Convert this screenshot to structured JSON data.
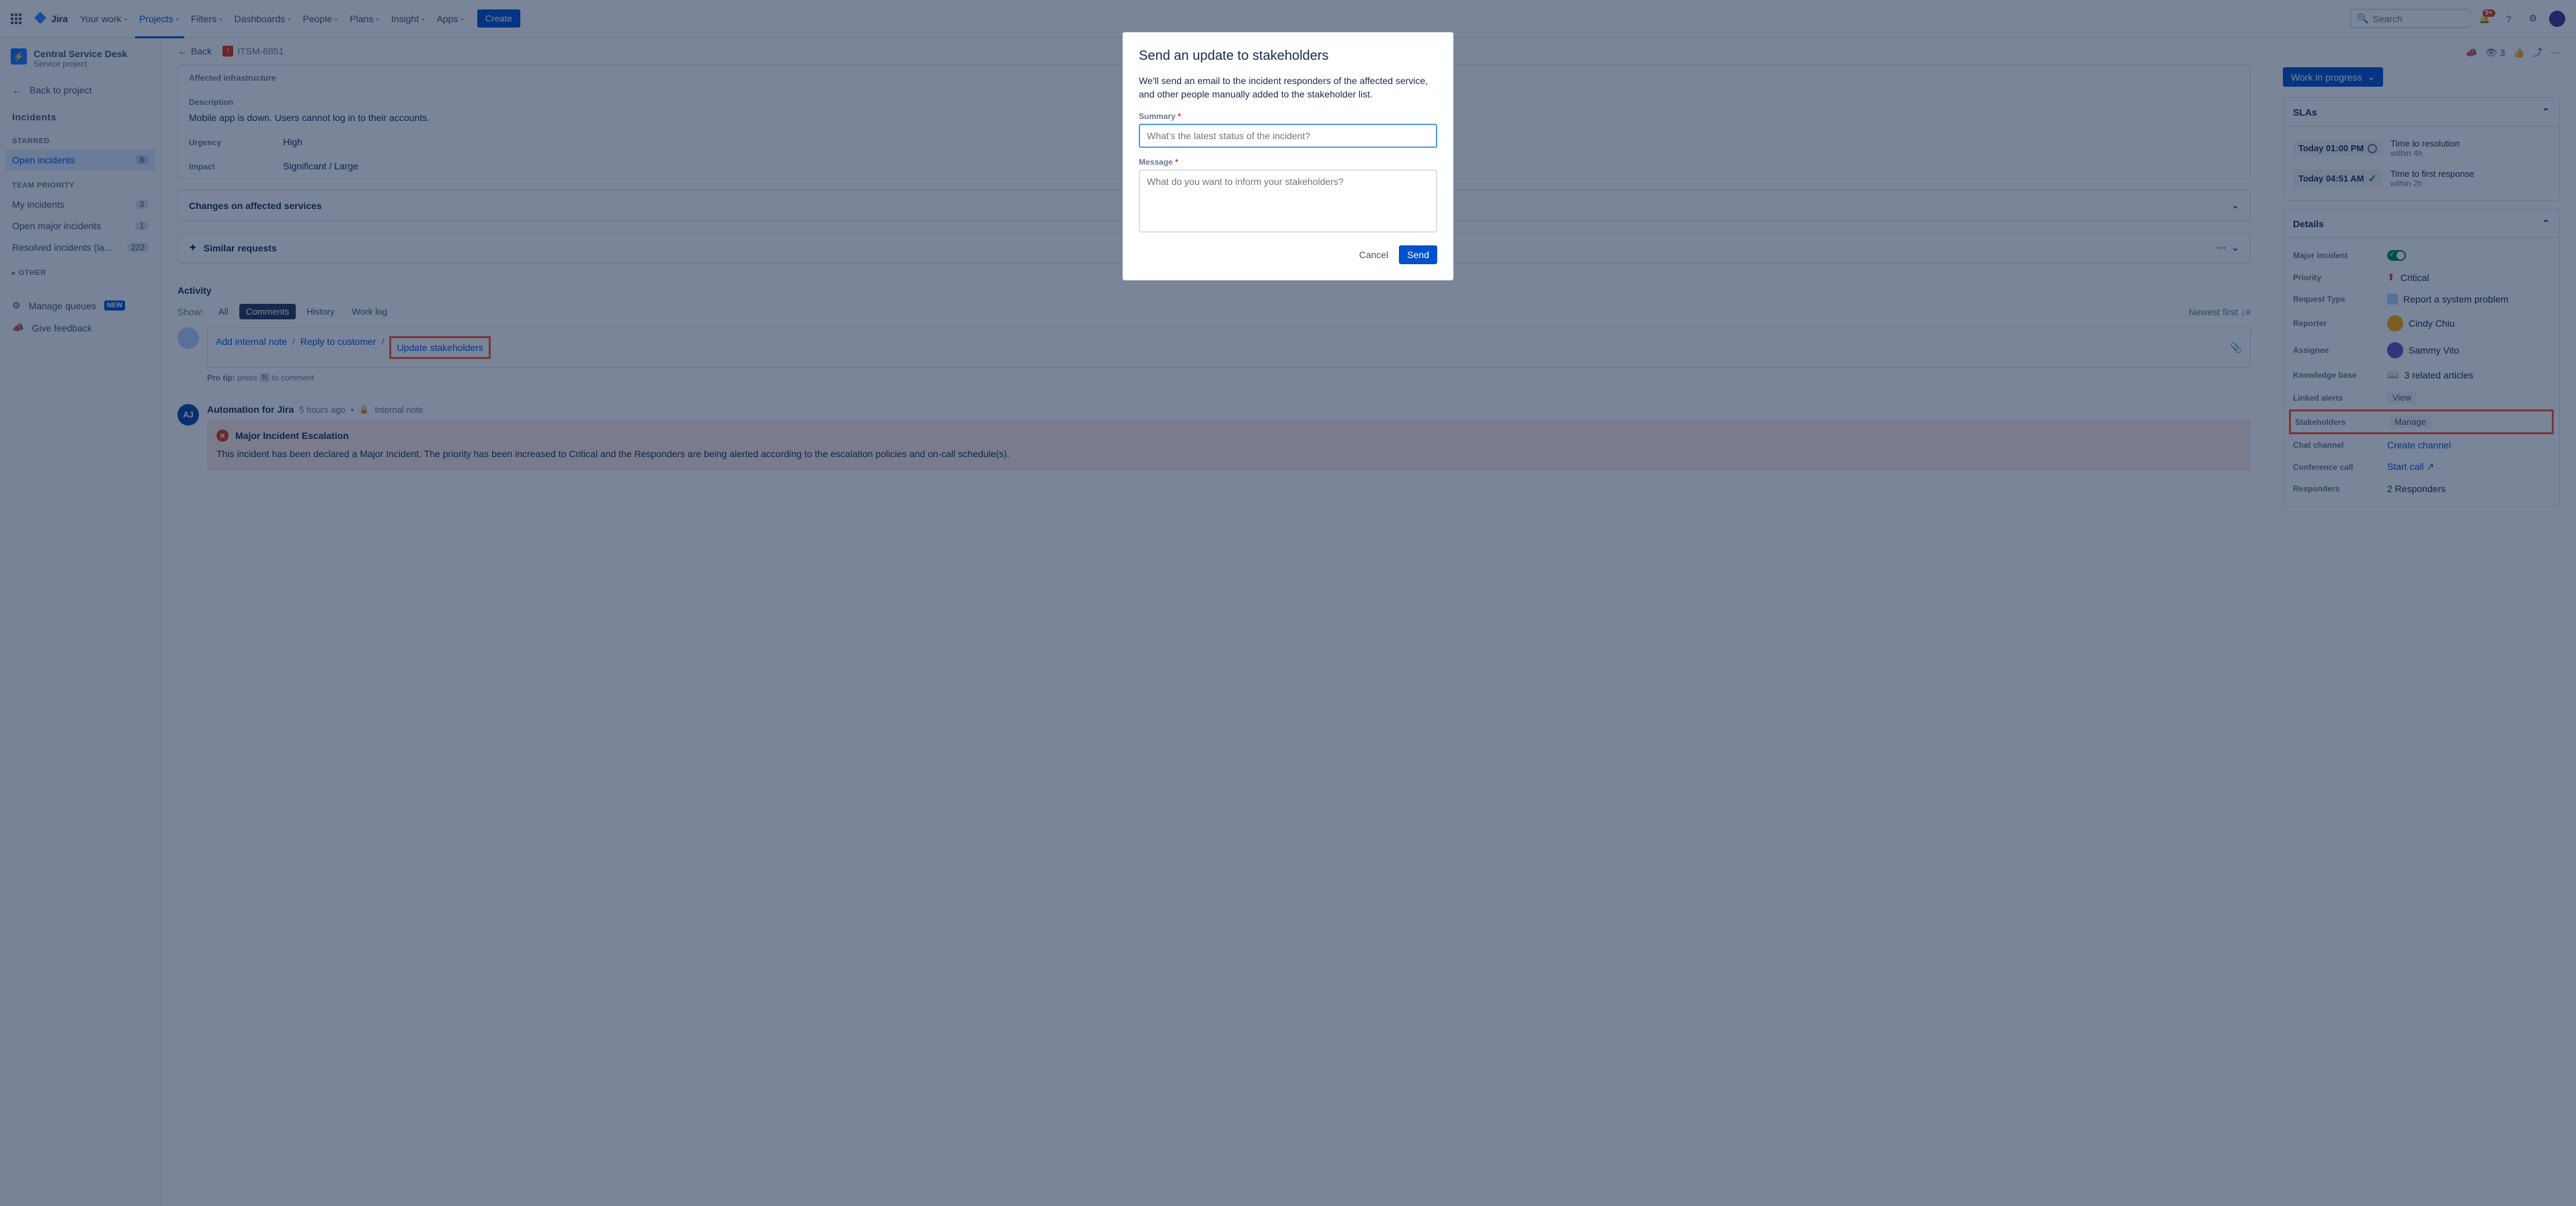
{
  "topnav": {
    "product": "Jira",
    "items": [
      "Your work",
      "Projects",
      "Filters",
      "Dashboards",
      "People",
      "Plans",
      "Insight",
      "Apps"
    ],
    "create": "Create",
    "search_placeholder": "Search",
    "notif_badge": "9+"
  },
  "sidebar": {
    "project_name": "Central Service Desk",
    "project_type": "Service project",
    "back_to_project": "Back to project",
    "incidents_heading": "Incidents",
    "starred_heading": "STARRED",
    "team_priority_heading": "TEAM PRIORITY",
    "other_heading": "OTHER",
    "queues": {
      "open_incidents": {
        "label": "Open incidents",
        "count": "8"
      },
      "my_incidents": {
        "label": "My incidents",
        "count": "3"
      },
      "open_major": {
        "label": "Open major incidents",
        "count": "1"
      },
      "resolved": {
        "label": "Resolved incidents (la...",
        "count": "222"
      }
    },
    "manage_queues": "Manage queues",
    "new_badge": "NEW",
    "give_feedback": "Give feedback"
  },
  "crumbs": {
    "back": "Back",
    "issue_key": "ITSM-6851"
  },
  "fields": {
    "infra_label": "Affected infrastructure",
    "desc_label": "Description",
    "desc_value": "Mobile app is down. Users cannot log in to their accounts.",
    "urgency_label": "Urgency",
    "urgency_value": "High",
    "impact_label": "Impact",
    "impact_value": "Significant / Large"
  },
  "panels": {
    "changes": "Changes on affected services",
    "similar": "Similar requests"
  },
  "activity": {
    "title": "Activity",
    "show": "Show:",
    "filters": {
      "all": "All",
      "comments": "Comments",
      "history": "History",
      "worklog": "Work log"
    },
    "newest_first": "Newest first",
    "links": {
      "internal": "Add internal note",
      "reply": "Reply to customer",
      "update": "Update stakeholders"
    },
    "protip_label": "Pro tip:",
    "protip_press": "press",
    "protip_key": "M",
    "protip_rest": "to comment",
    "comment": {
      "avatar": "AJ",
      "author": "Automation for Jira",
      "time": "5 hours ago",
      "type": "Internal note",
      "esc_title": "Major Incident Escalation",
      "esc_body": "This incident has been declared a Major Incident. The priority has been increased to Critical and the Responders are being alerted according to the escalation policies and on-call schedule(s)."
    }
  },
  "right": {
    "watchers": "3",
    "status": "Work in progress",
    "slas_title": "SLAs",
    "sla1": {
      "time": "Today 01:00 PM",
      "name": "Time to resolution",
      "within": "within 4h"
    },
    "sla2": {
      "time": "Today 04:51 AM",
      "name": "Time to first response",
      "within": "within 2h"
    },
    "details_title": "Details",
    "rows": {
      "major": {
        "label": "Major incident"
      },
      "priority": {
        "label": "Priority",
        "value": "Critical"
      },
      "reqtype": {
        "label": "Request Type",
        "value": "Report a system problem"
      },
      "reporter": {
        "label": "Reporter",
        "value": "Cindy Chiu"
      },
      "assignee": {
        "label": "Assignee",
        "value": "Sammy Vito"
      },
      "kb": {
        "label": "Knowledge base",
        "value": "3 related articles"
      },
      "alerts": {
        "label": "Linked alerts",
        "value": "View"
      },
      "stakeholders": {
        "label": "Stakeholders",
        "value": "Manage"
      },
      "chat": {
        "label": "Chat channel",
        "value": "Create channel"
      },
      "conf": {
        "label": "Conference call",
        "value": "Start call"
      },
      "responders": {
        "label": "Responders",
        "value": "2 Responders"
      }
    }
  },
  "modal": {
    "title": "Send an update to stakeholders",
    "desc": "We'll send an email to the incident responders of the affected service, and other people manually added to the stakeholder list.",
    "summary_label": "Summary",
    "summary_placeholder": "What's the latest status of the incident?",
    "message_label": "Message",
    "message_placeholder": "What do you want to inform your stakeholders?",
    "cancel": "Cancel",
    "send": "Send"
  }
}
